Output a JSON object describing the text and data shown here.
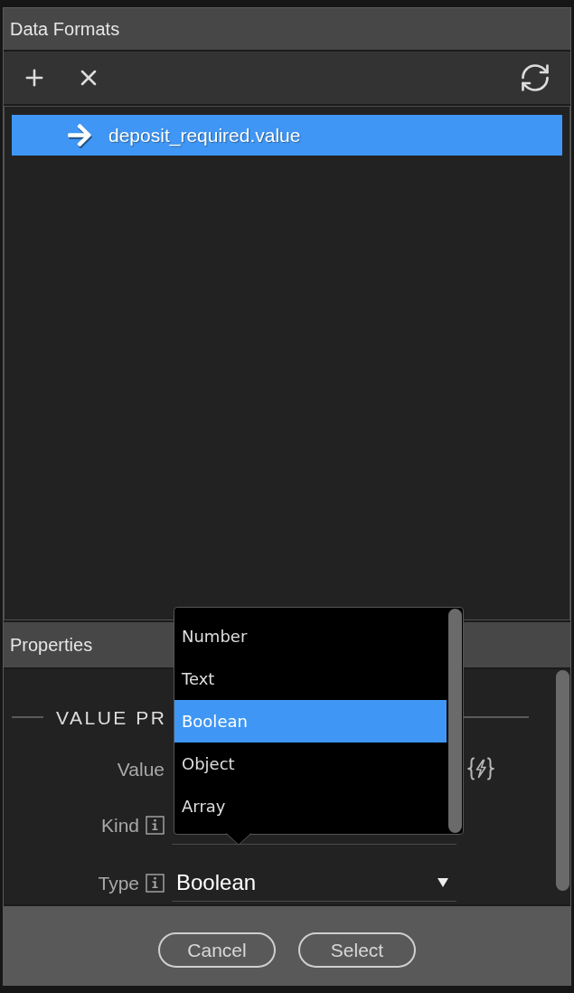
{
  "window": {
    "title": "Data Formats"
  },
  "formats": {
    "items": [
      {
        "label": "deposit_required.value",
        "selected": true
      }
    ]
  },
  "properties": {
    "title": "Properties",
    "section_title": "VALUE PR",
    "fields": [
      {
        "kind": "dynamic",
        "label": "Value",
        "info": false
      },
      {
        "kind": "text",
        "label": "Kind",
        "info": true
      },
      {
        "kind": "select",
        "label": "Type",
        "info": true,
        "value": "Boolean",
        "expanded": true,
        "options": [
          {
            "label": "Number",
            "selected": false
          },
          {
            "label": "Text",
            "selected": false
          },
          {
            "label": "Boolean",
            "selected": true
          },
          {
            "label": "Object",
            "selected": false
          },
          {
            "label": "Array",
            "selected": false
          }
        ]
      }
    ]
  },
  "buttons": [
    "Cancel",
    "Select"
  ]
}
